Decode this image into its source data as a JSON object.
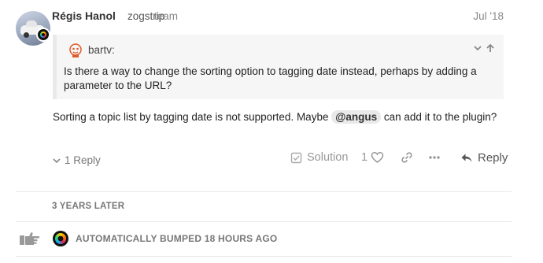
{
  "post": {
    "author_name": "Régis Hanol",
    "username": "zogstrip",
    "group": "team",
    "date": "Jul '18",
    "quote": {
      "author": "bartv:",
      "text": "Is there a way to change the sorting option to tagging date instead, perhaps by adding a parameter to the URL?"
    },
    "body_before": "Sorting a topic list by tagging date is not supported. Maybe ",
    "mention": "@angus",
    "body_after": " can add it to the plugin?"
  },
  "actions": {
    "replies_label": "1 Reply",
    "solution_label": "Solution",
    "like_count": "1",
    "reply_label": "Reply"
  },
  "gap": {
    "label": "3 YEARS LATER"
  },
  "bump": {
    "label": "AUTOMATICALLY BUMPED 18 HOURS AGO"
  },
  "icons": {
    "avatar": "user-avatar",
    "quote_avatar": "bartv-avatar",
    "chevron": "chevron-down-icon",
    "arrow_up": "arrow-up-icon",
    "replies_chevron": "chevron-down-icon",
    "solution": "checkbox-icon",
    "like": "heart-icon",
    "link": "link-icon",
    "more": "ellipsis-icon",
    "reply": "reply-arrow-icon",
    "bump": "pointing-hand-icon"
  }
}
